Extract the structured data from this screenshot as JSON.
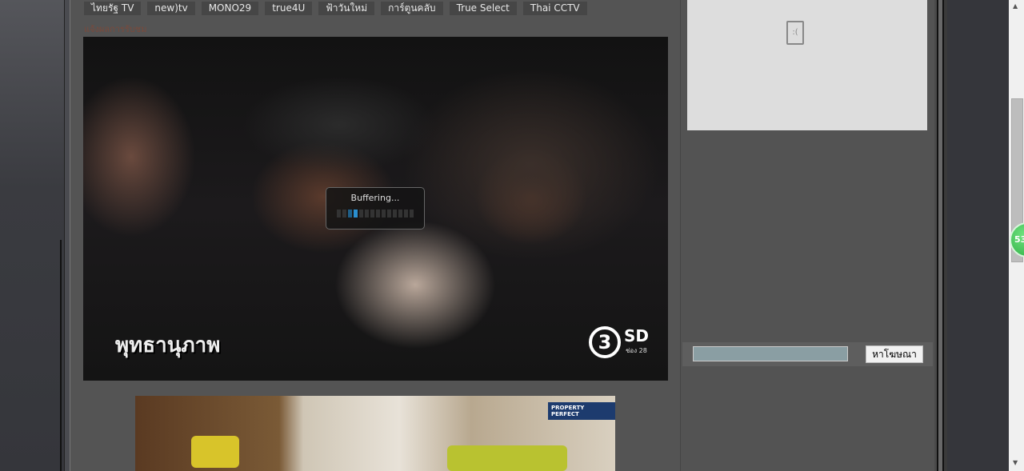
{
  "nav_tabs": [
    "ไทยรัฐ TV",
    "new)tv",
    "MONO29",
    "true4U",
    "ฟ้าวันใหม่",
    "การ์ตูนคลับ",
    "True Select",
    "Thai CCTV"
  ],
  "report_link": "แจ้งผลการรับชม",
  "video": {
    "status": "Buffering...",
    "buffer_progress_segments": {
      "total": 14,
      "filled": 2
    },
    "caption": "พุทธานุภาพ",
    "channel_logo": "3",
    "channel_quality": "SD",
    "channel_number": "ช่อง 28"
  },
  "ad_banner": {
    "brand": "PROPERTY PERFECT"
  },
  "sidebar": {
    "broken_image_icon": "broken-image-icon",
    "search_placeholder": "",
    "search_button": "หาโฆษณา"
  },
  "badge": {
    "count": "53"
  },
  "colors": {
    "panel": "#545454",
    "accent_buffer": "#2a8fd0",
    "badge": "#3cc257"
  }
}
